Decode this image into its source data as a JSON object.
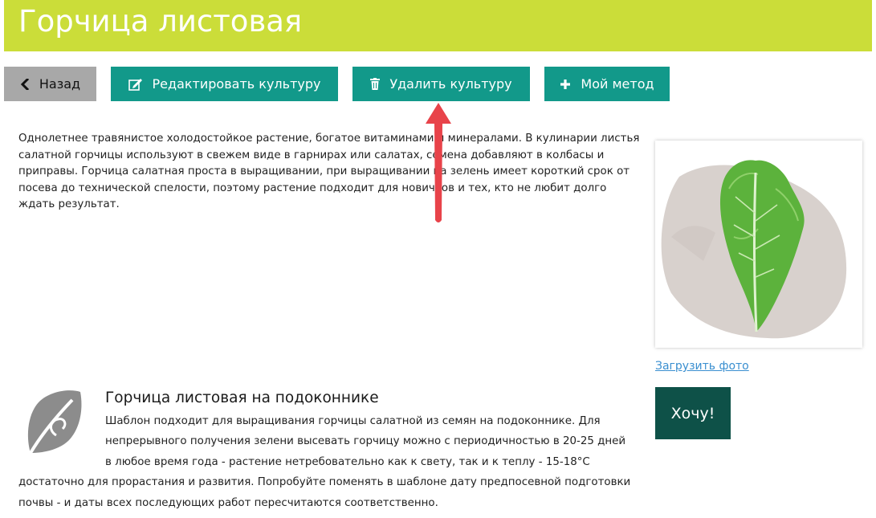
{
  "header": {
    "title": "Горчица листовая"
  },
  "toolbar": {
    "back_label": "Назад",
    "edit_label": "Редактировать культуру",
    "delete_label": "Удалить культуру",
    "method_label": "Мой метод"
  },
  "description": "Однолетнее травянистое холодостойкое растение, богатое витаминами и минералами. В кулинарии листья салатной горчицы используют в свежем виде в гарнирах или салатах, семена добавляют в колбасы и приправы. Горчица салатная проста в выращивании, при выращивании на зелень имеет короткий срок от посева до технической спелости, поэтому растение подходит для новичков и тех, кто не любит долго ждать результат.",
  "sidebar": {
    "upload_label": "Загрузить фото",
    "want_label": "Хочу!"
  },
  "template": {
    "title": "Горчица листовая на подоконнике",
    "line1": "Шаблон подходит для выращивания горчицы салатной из семян на подоконнике. Для",
    "line2": "непрерывного получения зелени высевать горчицу можно с периодичностью в 20-25 дней",
    "line3": "в любое время года - растение нетребовательно как к свету, так и к теплу - 15-18°C",
    "line4": "достаточно для прорастания и развития. Попробуйте поменять в шаблоне дату предпосевной подготовки",
    "line5": "почвы - и даты всех последующих работ пересчитаются соответственно."
  },
  "icons": {
    "back": "chevron-left-icon",
    "edit": "edit-icon",
    "delete": "trash-icon",
    "add": "plus-icon",
    "template": "leaf-icon"
  },
  "colors": {
    "header_bg": "#cbdd39",
    "teal_button": "#12998a",
    "back_button": "#a8a8a8",
    "want_button": "#0e5148",
    "link": "#3a8fd0",
    "annotation_arrow": "#e8434a"
  }
}
